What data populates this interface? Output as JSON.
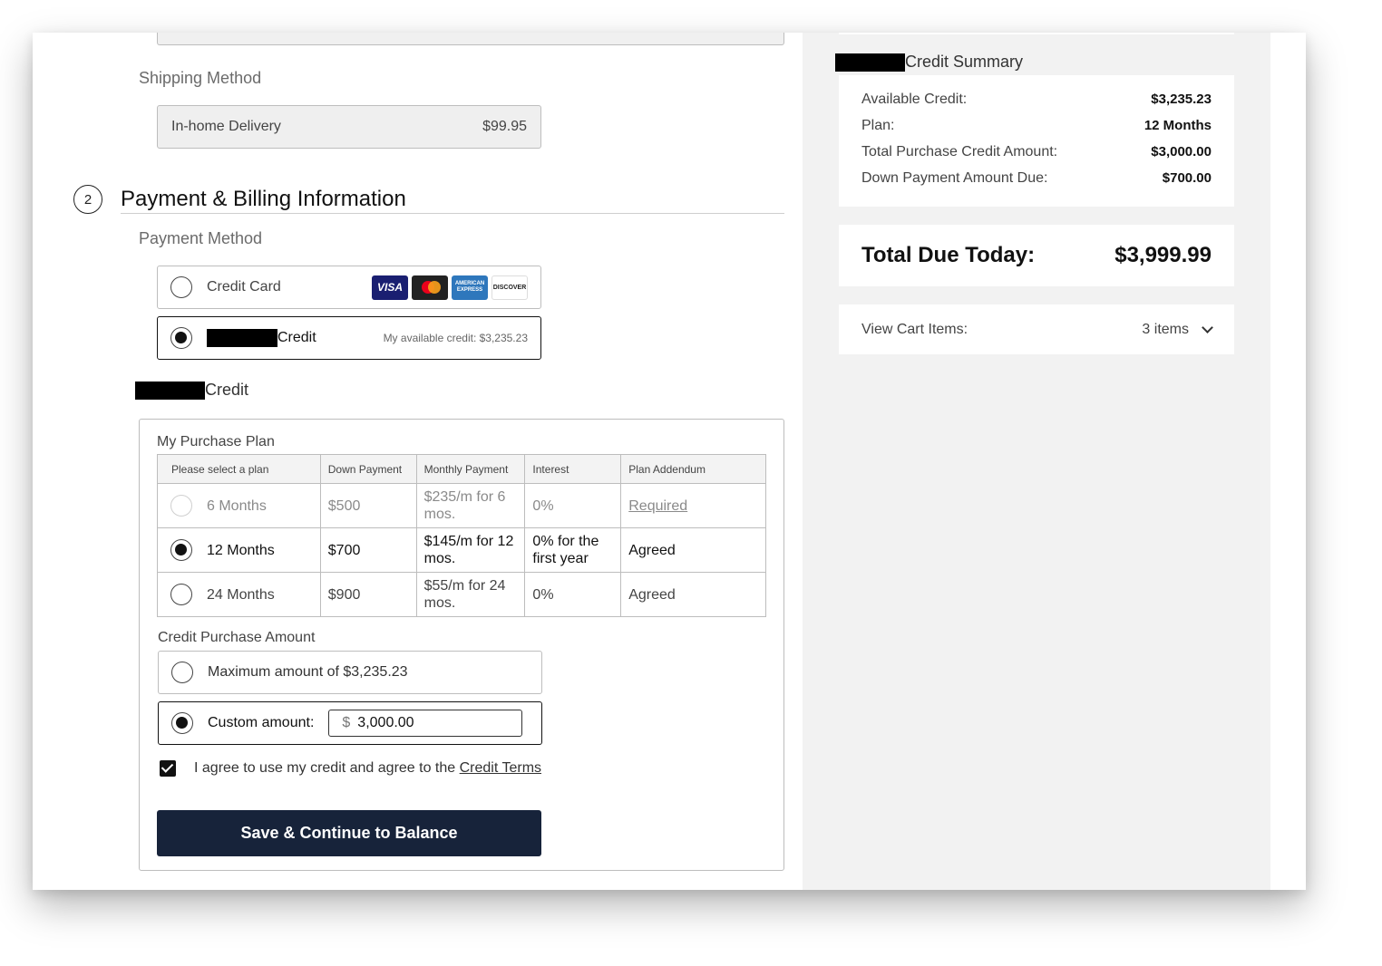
{
  "shipping": {
    "title": "Shipping Method",
    "option_label": "In-home Delivery",
    "option_price": "$99.95"
  },
  "payment_section": {
    "step_number": "2",
    "title": "Payment & Billing Information",
    "method_title": "Payment Method",
    "credit_card_label": "Credit Card",
    "card_logos": [
      "VISA",
      "mastercard",
      "AMERICAN EXPRESS",
      "DISCOVER"
    ],
    "credit_option_label": "Credit",
    "available_credit_note": "My available credit: $3,235.23"
  },
  "credit": {
    "heading": "Credit",
    "plan_box_title": "My Purchase Plan",
    "columns": [
      "Please select a plan",
      "Down Payment",
      "Monthly Payment",
      "Interest",
      "Plan Addendum"
    ],
    "plans": [
      {
        "name": "6 Months",
        "down": "$500",
        "monthly": "$235/m for 6 mos.",
        "interest": "0%",
        "addendum": "Required"
      },
      {
        "name": "12 Months",
        "down": "$700",
        "monthly": "$145/m for 12 mos.",
        "interest": "0% for the first year",
        "addendum": "Agreed"
      },
      {
        "name": "24 Months",
        "down": "$900",
        "monthly": "$55/m for 24 mos.",
        "interest": "0%",
        "addendum": "Agreed"
      }
    ],
    "purchase_amount_title": "Credit Purchase Amount",
    "max_option_label": "Maximum amount of $3,235.23",
    "custom_option_label": "Custom amount:",
    "custom_currency": "$",
    "custom_value": "3,000.00",
    "agree_text": "I agree to use my credit and agree to the ",
    "agree_link": "Credit Terms",
    "save_button": "Save & Continue to Balance"
  },
  "summary": {
    "heading": "Credit Summary",
    "rows": [
      {
        "label": "Available Credit:",
        "value": "$3,235.23"
      },
      {
        "label": "Plan:",
        "value": "12 Months"
      },
      {
        "label": "Total Purchase Credit Amount:",
        "value": "$3,000.00"
      },
      {
        "label": "Down Payment Amount Due:",
        "value": "$700.00"
      }
    ],
    "total_label": "Total Due Today:",
    "total_value": "$3,999.99",
    "cart_label": "View Cart Items:",
    "cart_count": "3 items"
  },
  "colors": {
    "primary_button": "#17233a",
    "sidebar_bg": "#f2f2f2"
  }
}
